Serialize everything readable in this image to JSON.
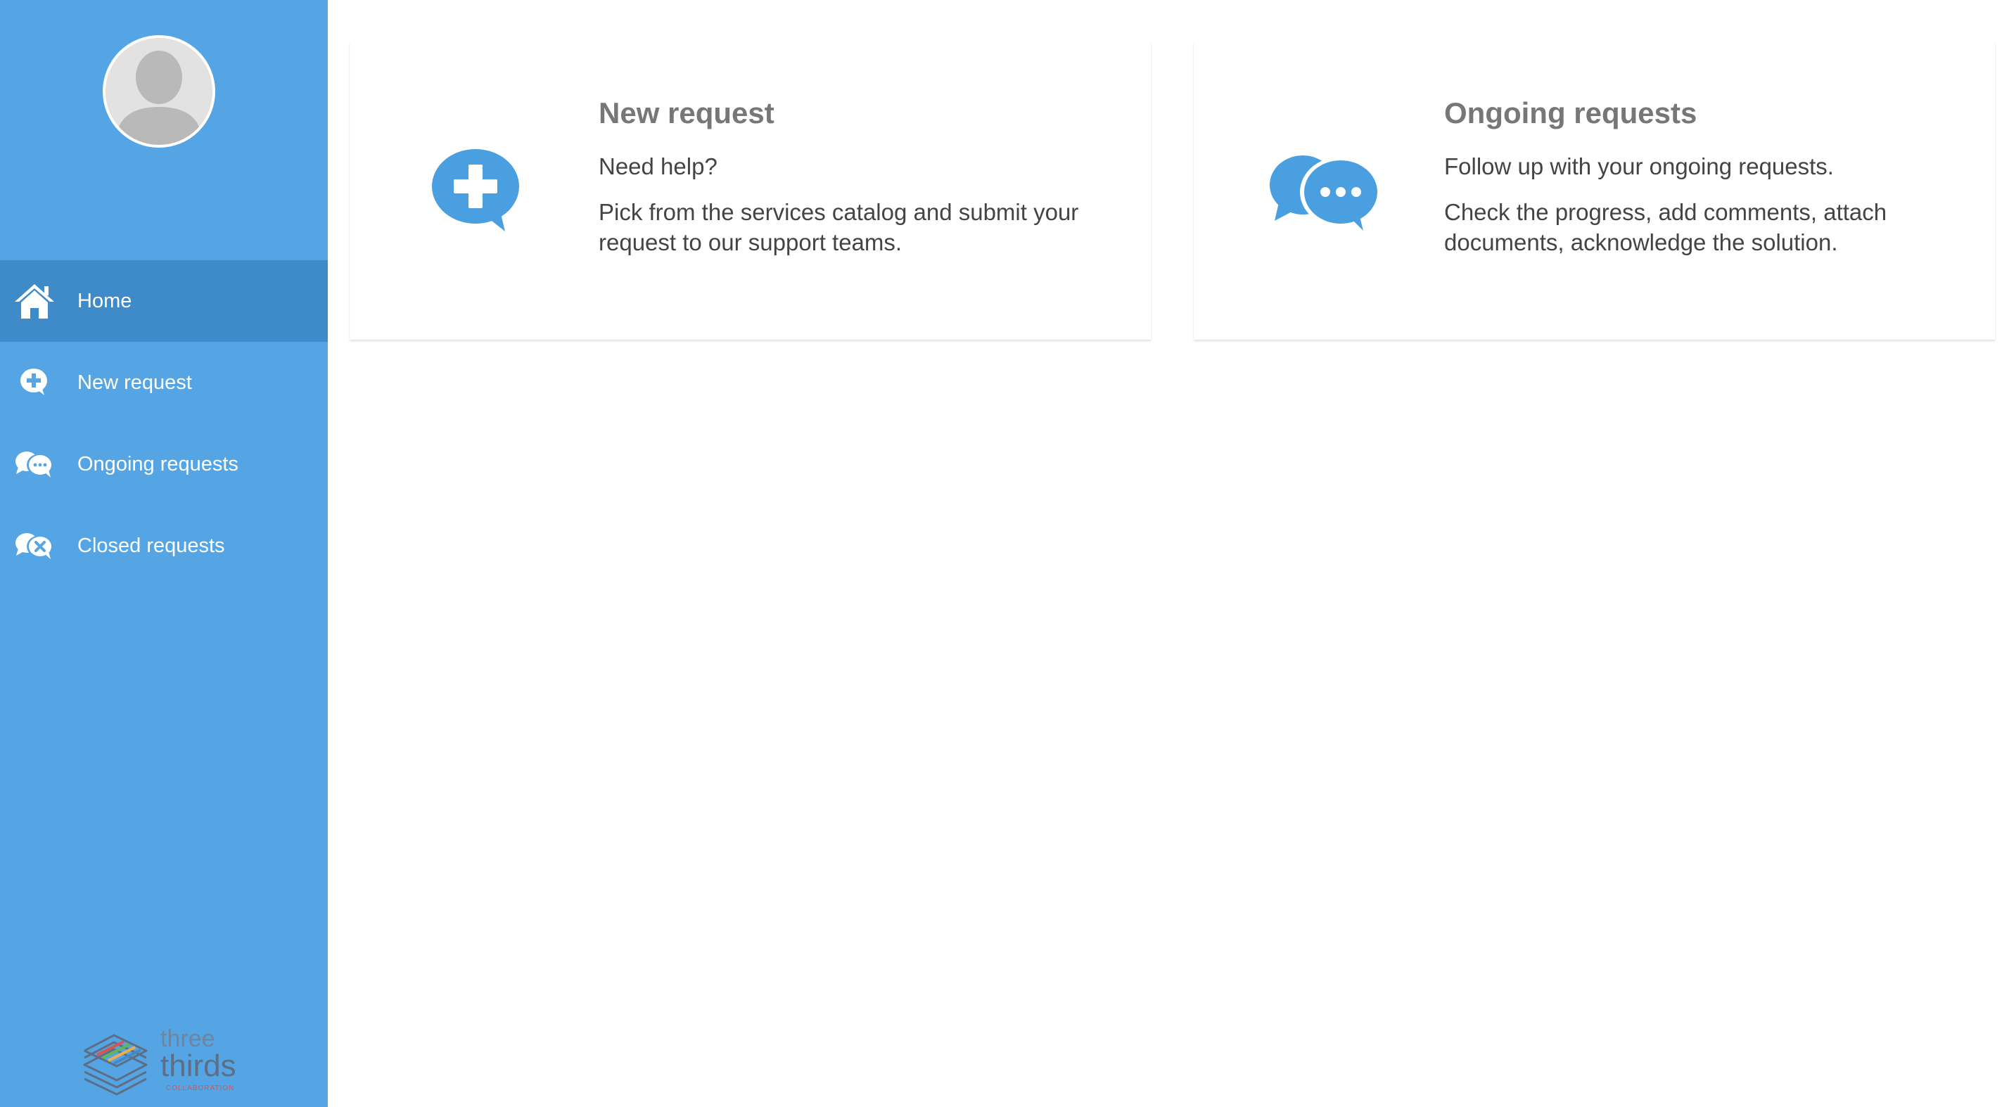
{
  "colors": {
    "sidebar": "#55a5e4",
    "sidebar_active": "#3f8ac8",
    "accent": "#4a9fe0",
    "title_text": "#777777",
    "body_text": "#444444"
  },
  "sidebar": {
    "avatar_icon": "user-avatar-placeholder",
    "items": [
      {
        "label": "Home",
        "icon": "home-icon",
        "active": true
      },
      {
        "label": "New request",
        "icon": "plus-bubble-icon",
        "active": false
      },
      {
        "label": "Ongoing requests",
        "icon": "chat-bubbles-icon",
        "active": false
      },
      {
        "label": "Closed requests",
        "icon": "closed-bubbles-icon",
        "active": false
      }
    ],
    "logo": {
      "line1": "three",
      "line2": "thirds",
      "line3": "COLLABORATION"
    }
  },
  "cards": [
    {
      "title": "New request",
      "icon": "plus-bubble-icon",
      "line1": "Need help?",
      "line2": "Pick from the services catalog and submit your request to our support teams."
    },
    {
      "title": "Ongoing requests",
      "icon": "chat-bubbles-icon",
      "line1": "Follow up with your ongoing requests.",
      "line2": "Check the progress, add comments, attach documents, acknowledge the solution."
    }
  ]
}
